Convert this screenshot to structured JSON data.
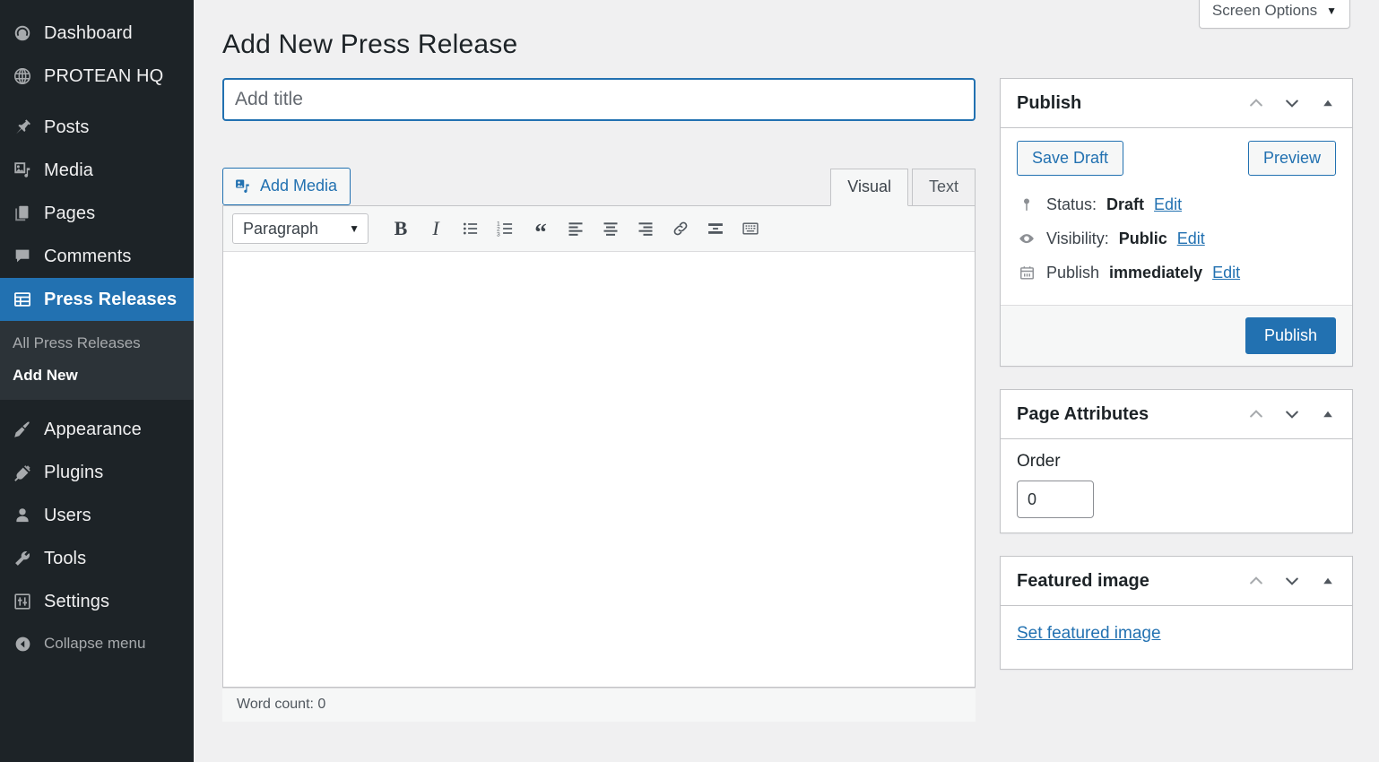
{
  "sidebar": {
    "items": [
      {
        "label": "Dashboard",
        "icon": "dashboard-gauge-icon"
      },
      {
        "label": "PROTEAN HQ",
        "icon": "globe-icon"
      },
      {
        "label": "Posts",
        "icon": "pin-icon"
      },
      {
        "label": "Media",
        "icon": "media-icon"
      },
      {
        "label": "Pages",
        "icon": "pages-icon"
      },
      {
        "label": "Comments",
        "icon": "comment-bubble-icon"
      },
      {
        "label": "Press Releases",
        "icon": "table-grid-icon",
        "current": true
      },
      {
        "label": "Appearance",
        "icon": "paintbrush-icon"
      },
      {
        "label": "Plugins",
        "icon": "plug-icon"
      },
      {
        "label": "Users",
        "icon": "user-icon"
      },
      {
        "label": "Tools",
        "icon": "wrench-icon"
      },
      {
        "label": "Settings",
        "icon": "sliders-icon"
      }
    ],
    "submenu": [
      {
        "label": "All Press Releases",
        "active": false
      },
      {
        "label": "Add New",
        "active": true
      }
    ],
    "collapse_label": "Collapse menu",
    "collapse_icon": "collapse-left-arrow-icon",
    "highlight_color": "#2271b1",
    "background_color": "#1d2327",
    "submenu_background_color": "#2c3338"
  },
  "header": {
    "screen_options_label": "Screen Options",
    "screen_options_caret": "▼",
    "page_title": "Add New Press Release"
  },
  "editor": {
    "title_placeholder": "Add title",
    "title_value": "",
    "add_media_label": "Add Media",
    "add_media_icon": "add-media-icon",
    "tabs": [
      {
        "label": "Visual",
        "active": true
      },
      {
        "label": "Text",
        "active": false
      }
    ],
    "format_select_value": "Paragraph",
    "format_select_caret": "▼",
    "toolbar_buttons": [
      {
        "name": "bold-icon",
        "glyph": "B"
      },
      {
        "name": "italic-icon",
        "glyph": "I"
      },
      {
        "name": "bulleted-list-icon",
        "glyph": ""
      },
      {
        "name": "numbered-list-icon",
        "glyph": ""
      },
      {
        "name": "blockquote-icon",
        "glyph": "“"
      },
      {
        "name": "align-left-icon",
        "glyph": ""
      },
      {
        "name": "align-center-icon",
        "glyph": ""
      },
      {
        "name": "align-right-icon",
        "glyph": ""
      },
      {
        "name": "link-icon",
        "glyph": ""
      },
      {
        "name": "insert-read-more-icon",
        "glyph": ""
      },
      {
        "name": "toolbar-toggle-keyboard-icon",
        "glyph": ""
      }
    ],
    "content": "",
    "word_count_label": "Word count: 0"
  },
  "publish_panel": {
    "title": "Publish",
    "save_draft_label": "Save Draft",
    "preview_label": "Preview",
    "status_label": "Status:",
    "status_value": "Draft",
    "status_edit": "Edit",
    "status_icon": "post-status-pin-icon",
    "visibility_label": "Visibility:",
    "visibility_value": "Public",
    "visibility_edit": "Edit",
    "visibility_icon": "eye-icon",
    "schedule_label": "Publish",
    "schedule_value": "immediately",
    "schedule_edit": "Edit",
    "schedule_icon": "calendar-icon",
    "publish_label": "Publish",
    "publish_button_color": "#2271b1"
  },
  "page_attributes_panel": {
    "title": "Page Attributes",
    "order_label": "Order",
    "order_value": "0"
  },
  "featured_image_panel": {
    "title": "Featured image",
    "set_featured_image_label": "Set featured image"
  },
  "panel_controls": {
    "up_icon": "chevron-up-icon",
    "down_icon": "chevron-down-icon",
    "toggle_icon": "toggle-panel-triangle-icon"
  }
}
